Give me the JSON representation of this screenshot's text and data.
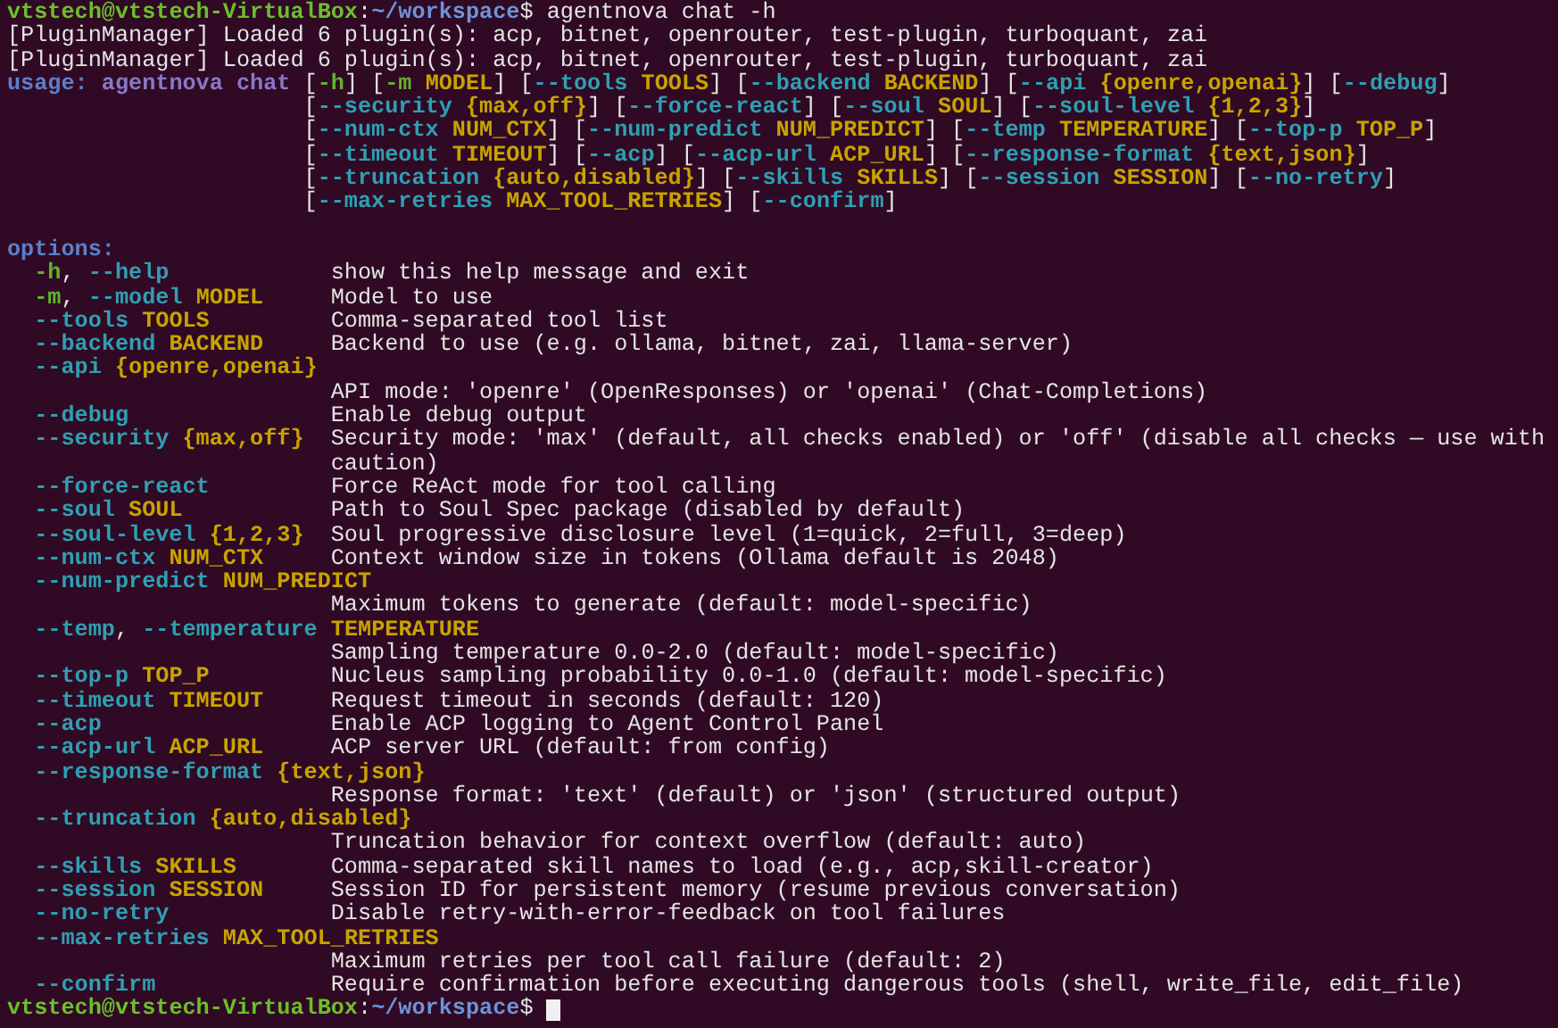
{
  "terminal": {
    "prompt": {
      "user_host": "vtstech@vtstech-VirtualBox",
      "separator": ":",
      "path": "~/workspace",
      "symbol": "$",
      "command": "agentnova chat -h"
    },
    "log_lines": [
      "[PluginManager] Loaded 6 plugin(s): acp, bitnet, openrouter, test-plugin, turboquant, zai",
      "[PluginManager] Loaded 6 plugin(s): acp, bitnet, openrouter, test-plugin, turboquant, zai"
    ],
    "usage": {
      "label": "usage:",
      "program": "agentnova chat",
      "lines": [
        [
          {
            "kind": "punct",
            "text": "["
          },
          {
            "kind": "short",
            "text": "-h"
          },
          {
            "kind": "punct",
            "text": "] ["
          },
          {
            "kind": "short",
            "text": "-m "
          },
          {
            "kind": "metavar",
            "text": "MODEL"
          },
          {
            "kind": "punct",
            "text": "] ["
          },
          {
            "kind": "long",
            "text": "--tools "
          },
          {
            "kind": "metavar",
            "text": "TOOLS"
          },
          {
            "kind": "punct",
            "text": "] ["
          },
          {
            "kind": "long",
            "text": "--backend "
          },
          {
            "kind": "metavar",
            "text": "BACKEND"
          },
          {
            "kind": "punct",
            "text": "] ["
          },
          {
            "kind": "long",
            "text": "--api "
          },
          {
            "kind": "metavar",
            "text": "{openre,openai}"
          },
          {
            "kind": "punct",
            "text": "] ["
          },
          {
            "kind": "long",
            "text": "--debug"
          },
          {
            "kind": "punct",
            "text": "]"
          }
        ],
        [
          {
            "kind": "punct",
            "text": "["
          },
          {
            "kind": "long",
            "text": "--security "
          },
          {
            "kind": "metavar",
            "text": "{max,off}"
          },
          {
            "kind": "punct",
            "text": "] ["
          },
          {
            "kind": "long",
            "text": "--force-react"
          },
          {
            "kind": "punct",
            "text": "] ["
          },
          {
            "kind": "long",
            "text": "--soul "
          },
          {
            "kind": "metavar",
            "text": "SOUL"
          },
          {
            "kind": "punct",
            "text": "] ["
          },
          {
            "kind": "long",
            "text": "--soul-level "
          },
          {
            "kind": "metavar",
            "text": "{1,2,3}"
          },
          {
            "kind": "punct",
            "text": "]"
          }
        ],
        [
          {
            "kind": "punct",
            "text": "["
          },
          {
            "kind": "long",
            "text": "--num-ctx "
          },
          {
            "kind": "metavar",
            "text": "NUM_CTX"
          },
          {
            "kind": "punct",
            "text": "] ["
          },
          {
            "kind": "long",
            "text": "--num-predict "
          },
          {
            "kind": "metavar",
            "text": "NUM_PREDICT"
          },
          {
            "kind": "punct",
            "text": "] ["
          },
          {
            "kind": "long",
            "text": "--temp "
          },
          {
            "kind": "metavar",
            "text": "TEMPERATURE"
          },
          {
            "kind": "punct",
            "text": "] ["
          },
          {
            "kind": "long",
            "text": "--top-p "
          },
          {
            "kind": "metavar",
            "text": "TOP_P"
          },
          {
            "kind": "punct",
            "text": "]"
          }
        ],
        [
          {
            "kind": "punct",
            "text": "["
          },
          {
            "kind": "long",
            "text": "--timeout "
          },
          {
            "kind": "metavar",
            "text": "TIMEOUT"
          },
          {
            "kind": "punct",
            "text": "] ["
          },
          {
            "kind": "long",
            "text": "--acp"
          },
          {
            "kind": "punct",
            "text": "] ["
          },
          {
            "kind": "long",
            "text": "--acp-url "
          },
          {
            "kind": "metavar",
            "text": "ACP_URL"
          },
          {
            "kind": "punct",
            "text": "] ["
          },
          {
            "kind": "long",
            "text": "--response-format "
          },
          {
            "kind": "metavar",
            "text": "{text,json}"
          },
          {
            "kind": "punct",
            "text": "]"
          }
        ],
        [
          {
            "kind": "punct",
            "text": "["
          },
          {
            "kind": "long",
            "text": "--truncation "
          },
          {
            "kind": "metavar",
            "text": "{auto,disabled}"
          },
          {
            "kind": "punct",
            "text": "] ["
          },
          {
            "kind": "long",
            "text": "--skills "
          },
          {
            "kind": "metavar",
            "text": "SKILLS"
          },
          {
            "kind": "punct",
            "text": "] ["
          },
          {
            "kind": "long",
            "text": "--session "
          },
          {
            "kind": "metavar",
            "text": "SESSION"
          },
          {
            "kind": "punct",
            "text": "] ["
          },
          {
            "kind": "long",
            "text": "--no-retry"
          },
          {
            "kind": "punct",
            "text": "]"
          }
        ],
        [
          {
            "kind": "punct",
            "text": "["
          },
          {
            "kind": "long",
            "text": "--max-retries "
          },
          {
            "kind": "metavar",
            "text": "MAX_TOOL_RETRIES"
          },
          {
            "kind": "punct",
            "text": "] ["
          },
          {
            "kind": "long",
            "text": "--confirm"
          },
          {
            "kind": "punct",
            "text": "]"
          }
        ]
      ]
    },
    "options_heading": "options:",
    "options": [
      {
        "flags": [
          {
            "kind": "short",
            "text": "-h"
          },
          {
            "kind": "punct",
            "text": ", "
          },
          {
            "kind": "long",
            "text": "--help"
          }
        ],
        "help": [
          "show this help message and exit"
        ]
      },
      {
        "flags": [
          {
            "kind": "short",
            "text": "-m"
          },
          {
            "kind": "punct",
            "text": ", "
          },
          {
            "kind": "long",
            "text": "--model "
          },
          {
            "kind": "metavar",
            "text": "MODEL"
          }
        ],
        "help": [
          "Model to use"
        ]
      },
      {
        "flags": [
          {
            "kind": "long",
            "text": "--tools "
          },
          {
            "kind": "metavar",
            "text": "TOOLS"
          }
        ],
        "help": [
          "Comma-separated tool list"
        ]
      },
      {
        "flags": [
          {
            "kind": "long",
            "text": "--backend "
          },
          {
            "kind": "metavar",
            "text": "BACKEND"
          }
        ],
        "help": [
          "Backend to use (e.g. ollama, bitnet, zai, llama-server)"
        ]
      },
      {
        "flags": [
          {
            "kind": "long",
            "text": "--api "
          },
          {
            "kind": "metavar",
            "text": "{openre,openai}"
          }
        ],
        "help": [
          "API mode: 'openre' (OpenResponses) or 'openai' (Chat-Completions)"
        ]
      },
      {
        "flags": [
          {
            "kind": "long",
            "text": "--debug"
          }
        ],
        "help": [
          "Enable debug output"
        ]
      },
      {
        "flags": [
          {
            "kind": "long",
            "text": "--security "
          },
          {
            "kind": "metavar",
            "text": "{max,off}"
          }
        ],
        "help": [
          "Security mode: 'max' (default, all checks enabled) or 'off' (disable all checks — use with",
          "caution)"
        ]
      },
      {
        "flags": [
          {
            "kind": "long",
            "text": "--force-react"
          }
        ],
        "help": [
          "Force ReAct mode for tool calling"
        ]
      },
      {
        "flags": [
          {
            "kind": "long",
            "text": "--soul "
          },
          {
            "kind": "metavar",
            "text": "SOUL"
          }
        ],
        "help": [
          "Path to Soul Spec package (disabled by default)"
        ]
      },
      {
        "flags": [
          {
            "kind": "long",
            "text": "--soul-level "
          },
          {
            "kind": "metavar",
            "text": "{1,2,3}"
          }
        ],
        "help": [
          "Soul progressive disclosure level (1=quick, 2=full, 3=deep)"
        ]
      },
      {
        "flags": [
          {
            "kind": "long",
            "text": "--num-ctx "
          },
          {
            "kind": "metavar",
            "text": "NUM_CTX"
          }
        ],
        "help": [
          "Context window size in tokens (Ollama default is 2048)"
        ]
      },
      {
        "flags": [
          {
            "kind": "long",
            "text": "--num-predict "
          },
          {
            "kind": "metavar",
            "text": "NUM_PREDICT"
          }
        ],
        "help": [
          "Maximum tokens to generate (default: model-specific)"
        ]
      },
      {
        "flags": [
          {
            "kind": "long",
            "text": "--temp"
          },
          {
            "kind": "punct",
            "text": ", "
          },
          {
            "kind": "long",
            "text": "--temperature "
          },
          {
            "kind": "metavar",
            "text": "TEMPERATURE"
          }
        ],
        "help": [
          "Sampling temperature 0.0-2.0 (default: model-specific)"
        ]
      },
      {
        "flags": [
          {
            "kind": "long",
            "text": "--top-p "
          },
          {
            "kind": "metavar",
            "text": "TOP_P"
          }
        ],
        "help": [
          "Nucleus sampling probability 0.0-1.0 (default: model-specific)"
        ]
      },
      {
        "flags": [
          {
            "kind": "long",
            "text": "--timeout "
          },
          {
            "kind": "metavar",
            "text": "TIMEOUT"
          }
        ],
        "help": [
          "Request timeout in seconds (default: 120)"
        ]
      },
      {
        "flags": [
          {
            "kind": "long",
            "text": "--acp"
          }
        ],
        "help": [
          "Enable ACP logging to Agent Control Panel"
        ]
      },
      {
        "flags": [
          {
            "kind": "long",
            "text": "--acp-url "
          },
          {
            "kind": "metavar",
            "text": "ACP_URL"
          }
        ],
        "help": [
          "ACP server URL (default: from config)"
        ]
      },
      {
        "flags": [
          {
            "kind": "long",
            "text": "--response-format "
          },
          {
            "kind": "metavar",
            "text": "{text,json}"
          }
        ],
        "help": [
          "Response format: 'text' (default) or 'json' (structured output)"
        ]
      },
      {
        "flags": [
          {
            "kind": "long",
            "text": "--truncation "
          },
          {
            "kind": "metavar",
            "text": "{auto,disabled}"
          }
        ],
        "help": [
          "Truncation behavior for context overflow (default: auto)"
        ]
      },
      {
        "flags": [
          {
            "kind": "long",
            "text": "--skills "
          },
          {
            "kind": "metavar",
            "text": "SKILLS"
          }
        ],
        "help": [
          "Comma-separated skill names to load (e.g., acp,skill-creator)"
        ]
      },
      {
        "flags": [
          {
            "kind": "long",
            "text": "--session "
          },
          {
            "kind": "metavar",
            "text": "SESSION"
          }
        ],
        "help": [
          "Session ID for persistent memory (resume previous conversation)"
        ]
      },
      {
        "flags": [
          {
            "kind": "long",
            "text": "--no-retry"
          }
        ],
        "help": [
          "Disable retry-with-error-feedback on tool failures"
        ]
      },
      {
        "flags": [
          {
            "kind": "long",
            "text": "--max-retries "
          },
          {
            "kind": "metavar",
            "text": "MAX_TOOL_RETRIES"
          }
        ],
        "help": [
          "Maximum retries per tool call failure (default: 2)"
        ]
      },
      {
        "flags": [
          {
            "kind": "long",
            "text": "--confirm"
          }
        ],
        "help": [
          "Require confirmation before executing dangerous tools (shell, write_file, edit_file)"
        ]
      }
    ],
    "final_prompt": {
      "user_host": "vtstech@vtstech-VirtualBox",
      "separator": ":",
      "path": "~/workspace",
      "symbol": "$",
      "cursor": true
    }
  }
}
